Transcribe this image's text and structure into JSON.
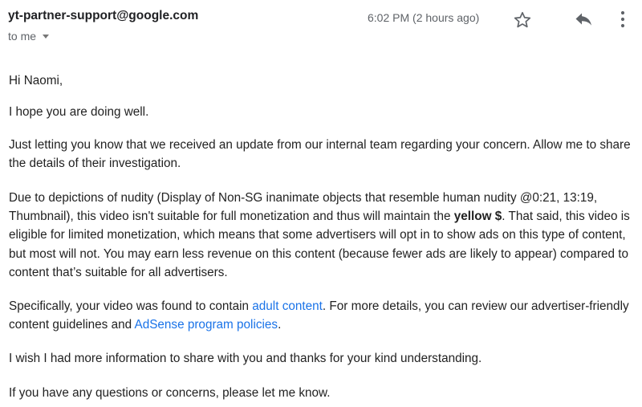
{
  "header": {
    "sender": "yt-partner-support@google.com",
    "recipient": "to me",
    "time": "6:02 PM (2 hours ago)",
    "icons": {
      "star": "star-icon",
      "reply": "reply-icon",
      "more": "more-vert-icon"
    }
  },
  "body": {
    "greeting": "Hi Naomi,",
    "hope": "I hope you are doing well.",
    "update": "Just letting you know that we received an update from our internal team regarding your concern. Allow me to share the details of their investigation.",
    "nudity": {
      "part1": "Due to depictions of nudity (Display of Non-SG inanimate objects that resemble human nudity @0:21, 13:19, Thumbnail), this video isn't suitable for full monetization and thus will maintain the ",
      "bold": "yellow $",
      "part2": ". That said, this video is eligible for limited monetization, which means that some advertisers will opt in to show ads on this type of content, but most will not. You may earn less revenue on this content (because fewer ads are likely to appear) compared to content that’s suitable for all advertisers."
    },
    "specific": {
      "part1": "Specifically, your video was found to contain ",
      "link1": "adult content",
      "part2": ". For more details, you can review  our advertiser-friendly content guidelines and ",
      "link2": "AdSense program policies",
      "part3": "."
    },
    "wish": "I wish I had more information to share with you and thanks for your kind understanding.",
    "questions": "If you have any questions or concerns, please let me know."
  },
  "colors": {
    "link": "#1a73e8",
    "text": "#222222",
    "muted": "#5f6368"
  }
}
